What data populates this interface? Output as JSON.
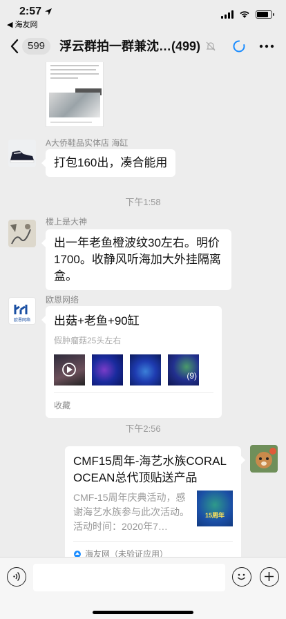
{
  "status_bar": {
    "time": "2:57",
    "back_app": "◀ 海友网",
    "battery_level": 0.8
  },
  "header": {
    "unread_count": "599",
    "title": "浮云群拍一群兼沈…",
    "member_count": "(499)",
    "icons": [
      "chevron-left-icon",
      "mute-bell-icon",
      "circle-icon",
      "more-icon"
    ]
  },
  "messages": [
    {
      "type": "image",
      "note": "partial screenshot image at top",
      "snippet_lines": [
        "bilibu1]蓝女鱼牧缸来第了，回复300/z",
        "水景 应需auli图西猫 黄地面鱼1号日 日",
        "小包含元，哪缸初就90、外有尺度搬家",
        "凑合能用"
      ]
    },
    {
      "type": "text",
      "sender": "A大侨鞋品实体店 海缸",
      "text": "打包160出，凑合能用"
    },
    {
      "type": "time",
      "text": "下午1:58"
    },
    {
      "type": "text",
      "sender": "楼上是大神",
      "text": "出一年老鱼橙波纹30左右。明价1700。收静风听海加大外挂隔离盒。"
    },
    {
      "type": "card",
      "sender": "欧恩网络",
      "avatar_text": "欧恩网络",
      "title": "出菇+老鱼+90缸",
      "subtitle": "假肿瘤菇25头左右",
      "more_count": "(9)",
      "footer": "收藏"
    },
    {
      "type": "time",
      "text": "下午2:56"
    },
    {
      "type": "link",
      "title": "CMF15周年-海艺水族CORAL OCEAN总代顶贴送产品",
      "desc": "CMF-15周年庆典活动，感谢海艺水族参与此次活动。活动时间：2020年7…",
      "thumb_text": "15周年",
      "source": "海友网（未验证应用）"
    }
  ],
  "input_bar": {
    "placeholder": "",
    "icons": [
      "voice-icon",
      "emoji-icon",
      "plus-icon"
    ]
  }
}
